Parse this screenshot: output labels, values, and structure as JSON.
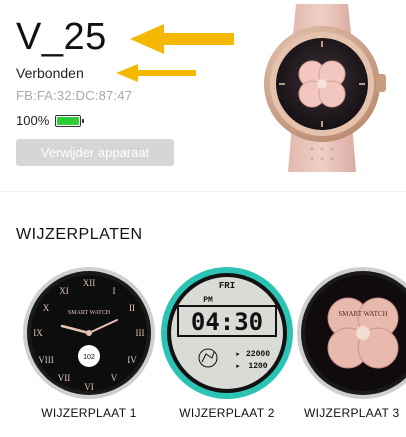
{
  "device": {
    "name": "V_25",
    "status": "Verbonden",
    "mac": "FB:FA:32:DC:87:47",
    "battery_text": "100%",
    "battery_level": 1.0,
    "remove_label": "Verwijder apparaat"
  },
  "watchfaces": {
    "title": "WIJZERPLATEN",
    "items": [
      {
        "label": "WIJZERPLAAT 1",
        "brand": "SMART WATCH",
        "value": "102"
      },
      {
        "label": "WIJZERPLAAT 2",
        "day": "FRI",
        "ampm": "PM",
        "time": "04:30",
        "steps": "22000",
        "cal": "1200"
      },
      {
        "label": "WIJZERPLAAT 3",
        "brand": "SMART WATCH"
      }
    ]
  },
  "colors": {
    "accent_arrow": "#f5b800",
    "battery": "#2fcc3a",
    "button_disabled": "#d6d6d6",
    "teal_ring": "#2bc3b4"
  }
}
